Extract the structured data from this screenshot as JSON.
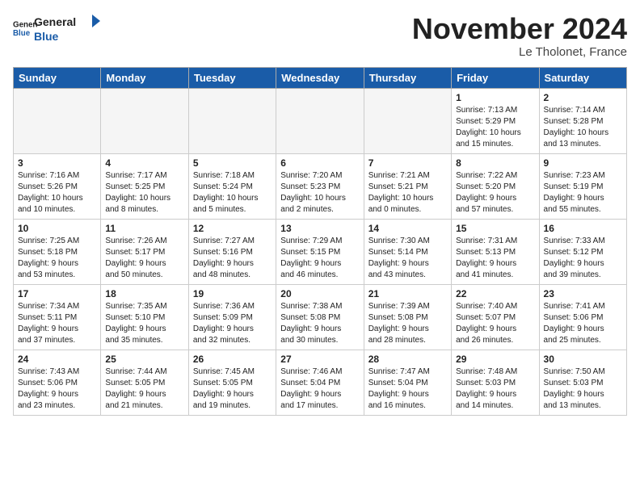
{
  "header": {
    "logo_line1": "General",
    "logo_line2": "Blue",
    "month": "November 2024",
    "location": "Le Tholonet, France"
  },
  "weekdays": [
    "Sunday",
    "Monday",
    "Tuesday",
    "Wednesday",
    "Thursday",
    "Friday",
    "Saturday"
  ],
  "weeks": [
    [
      {
        "day": null,
        "info": null
      },
      {
        "day": null,
        "info": null
      },
      {
        "day": null,
        "info": null
      },
      {
        "day": null,
        "info": null
      },
      {
        "day": null,
        "info": null
      },
      {
        "day": "1",
        "info": "Sunrise: 7:13 AM\nSunset: 5:29 PM\nDaylight: 10 hours\nand 15 minutes."
      },
      {
        "day": "2",
        "info": "Sunrise: 7:14 AM\nSunset: 5:28 PM\nDaylight: 10 hours\nand 13 minutes."
      }
    ],
    [
      {
        "day": "3",
        "info": "Sunrise: 7:16 AM\nSunset: 5:26 PM\nDaylight: 10 hours\nand 10 minutes."
      },
      {
        "day": "4",
        "info": "Sunrise: 7:17 AM\nSunset: 5:25 PM\nDaylight: 10 hours\nand 8 minutes."
      },
      {
        "day": "5",
        "info": "Sunrise: 7:18 AM\nSunset: 5:24 PM\nDaylight: 10 hours\nand 5 minutes."
      },
      {
        "day": "6",
        "info": "Sunrise: 7:20 AM\nSunset: 5:23 PM\nDaylight: 10 hours\nand 2 minutes."
      },
      {
        "day": "7",
        "info": "Sunrise: 7:21 AM\nSunset: 5:21 PM\nDaylight: 10 hours\nand 0 minutes."
      },
      {
        "day": "8",
        "info": "Sunrise: 7:22 AM\nSunset: 5:20 PM\nDaylight: 9 hours\nand 57 minutes."
      },
      {
        "day": "9",
        "info": "Sunrise: 7:23 AM\nSunset: 5:19 PM\nDaylight: 9 hours\nand 55 minutes."
      }
    ],
    [
      {
        "day": "10",
        "info": "Sunrise: 7:25 AM\nSunset: 5:18 PM\nDaylight: 9 hours\nand 53 minutes."
      },
      {
        "day": "11",
        "info": "Sunrise: 7:26 AM\nSunset: 5:17 PM\nDaylight: 9 hours\nand 50 minutes."
      },
      {
        "day": "12",
        "info": "Sunrise: 7:27 AM\nSunset: 5:16 PM\nDaylight: 9 hours\nand 48 minutes."
      },
      {
        "day": "13",
        "info": "Sunrise: 7:29 AM\nSunset: 5:15 PM\nDaylight: 9 hours\nand 46 minutes."
      },
      {
        "day": "14",
        "info": "Sunrise: 7:30 AM\nSunset: 5:14 PM\nDaylight: 9 hours\nand 43 minutes."
      },
      {
        "day": "15",
        "info": "Sunrise: 7:31 AM\nSunset: 5:13 PM\nDaylight: 9 hours\nand 41 minutes."
      },
      {
        "day": "16",
        "info": "Sunrise: 7:33 AM\nSunset: 5:12 PM\nDaylight: 9 hours\nand 39 minutes."
      }
    ],
    [
      {
        "day": "17",
        "info": "Sunrise: 7:34 AM\nSunset: 5:11 PM\nDaylight: 9 hours\nand 37 minutes."
      },
      {
        "day": "18",
        "info": "Sunrise: 7:35 AM\nSunset: 5:10 PM\nDaylight: 9 hours\nand 35 minutes."
      },
      {
        "day": "19",
        "info": "Sunrise: 7:36 AM\nSunset: 5:09 PM\nDaylight: 9 hours\nand 32 minutes."
      },
      {
        "day": "20",
        "info": "Sunrise: 7:38 AM\nSunset: 5:08 PM\nDaylight: 9 hours\nand 30 minutes."
      },
      {
        "day": "21",
        "info": "Sunrise: 7:39 AM\nSunset: 5:08 PM\nDaylight: 9 hours\nand 28 minutes."
      },
      {
        "day": "22",
        "info": "Sunrise: 7:40 AM\nSunset: 5:07 PM\nDaylight: 9 hours\nand 26 minutes."
      },
      {
        "day": "23",
        "info": "Sunrise: 7:41 AM\nSunset: 5:06 PM\nDaylight: 9 hours\nand 25 minutes."
      }
    ],
    [
      {
        "day": "24",
        "info": "Sunrise: 7:43 AM\nSunset: 5:06 PM\nDaylight: 9 hours\nand 23 minutes."
      },
      {
        "day": "25",
        "info": "Sunrise: 7:44 AM\nSunset: 5:05 PM\nDaylight: 9 hours\nand 21 minutes."
      },
      {
        "day": "26",
        "info": "Sunrise: 7:45 AM\nSunset: 5:05 PM\nDaylight: 9 hours\nand 19 minutes."
      },
      {
        "day": "27",
        "info": "Sunrise: 7:46 AM\nSunset: 5:04 PM\nDaylight: 9 hours\nand 17 minutes."
      },
      {
        "day": "28",
        "info": "Sunrise: 7:47 AM\nSunset: 5:04 PM\nDaylight: 9 hours\nand 16 minutes."
      },
      {
        "day": "29",
        "info": "Sunrise: 7:48 AM\nSunset: 5:03 PM\nDaylight: 9 hours\nand 14 minutes."
      },
      {
        "day": "30",
        "info": "Sunrise: 7:50 AM\nSunset: 5:03 PM\nDaylight: 9 hours\nand 13 minutes."
      }
    ]
  ]
}
